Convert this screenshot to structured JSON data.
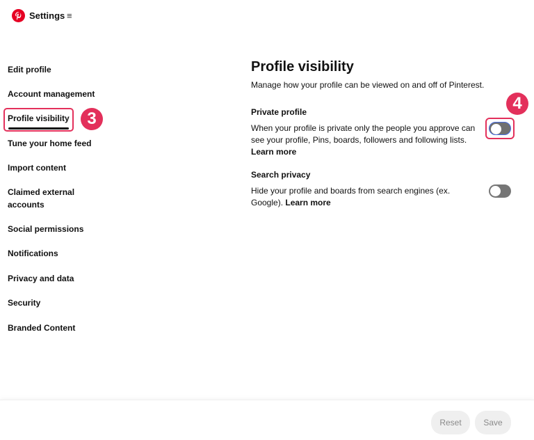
{
  "header": {
    "title": "Settings",
    "logo_icon": "pinterest-logo",
    "menu_icon": "hamburger-menu-icon",
    "brand_color": "#e60023"
  },
  "sidebar": {
    "items": [
      {
        "label": "Edit profile"
      },
      {
        "label": "Account management"
      },
      {
        "label": "Profile visibility",
        "active": true
      },
      {
        "label": "Tune your home feed"
      },
      {
        "label": "Import content"
      },
      {
        "label": "Claimed external accounts"
      },
      {
        "label": "Social permissions"
      },
      {
        "label": "Notifications"
      },
      {
        "label": "Privacy and data"
      },
      {
        "label": "Security"
      },
      {
        "label": "Branded Content"
      }
    ]
  },
  "annotations": {
    "step_3": "3",
    "step_4": "4",
    "color": "#e3305b"
  },
  "main": {
    "title": "Profile visibility",
    "subtitle": "Manage how your profile can be viewed on and off of Pinterest.",
    "private_profile": {
      "title": "Private profile",
      "description": "When your profile is private only the people you approve can see your profile, Pins, boards, followers and following lists.",
      "learn_more": "Learn more",
      "enabled": false
    },
    "search_privacy": {
      "title": "Search privacy",
      "description": "Hide your profile and boards from search engines (ex. Google).",
      "learn_more": "Learn more",
      "enabled": false
    }
  },
  "footer": {
    "reset_label": "Reset",
    "save_label": "Save"
  }
}
